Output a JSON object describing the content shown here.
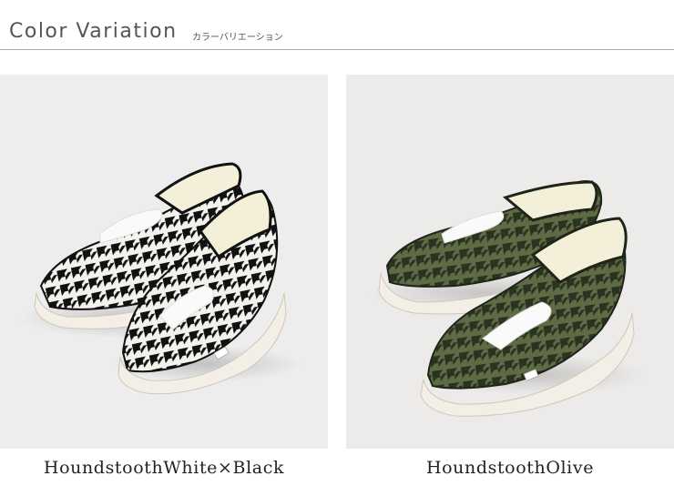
{
  "header": {
    "title": "Color Variation",
    "subtitle": "カラーバリエーション"
  },
  "variations": [
    {
      "label": "HoundstoothWhite×Black",
      "pattern_dark": "#111111",
      "pattern_light": "#f4f2ec"
    },
    {
      "label": "HoundstoothOlive",
      "pattern_dark": "#2a3220",
      "pattern_light": "#5e6b44"
    }
  ],
  "colors": {
    "text": "#555555",
    "rule": "#aaaaaa",
    "sole": "#f3efe6",
    "lining": "#f4efd9",
    "lace": "#fafafa"
  }
}
